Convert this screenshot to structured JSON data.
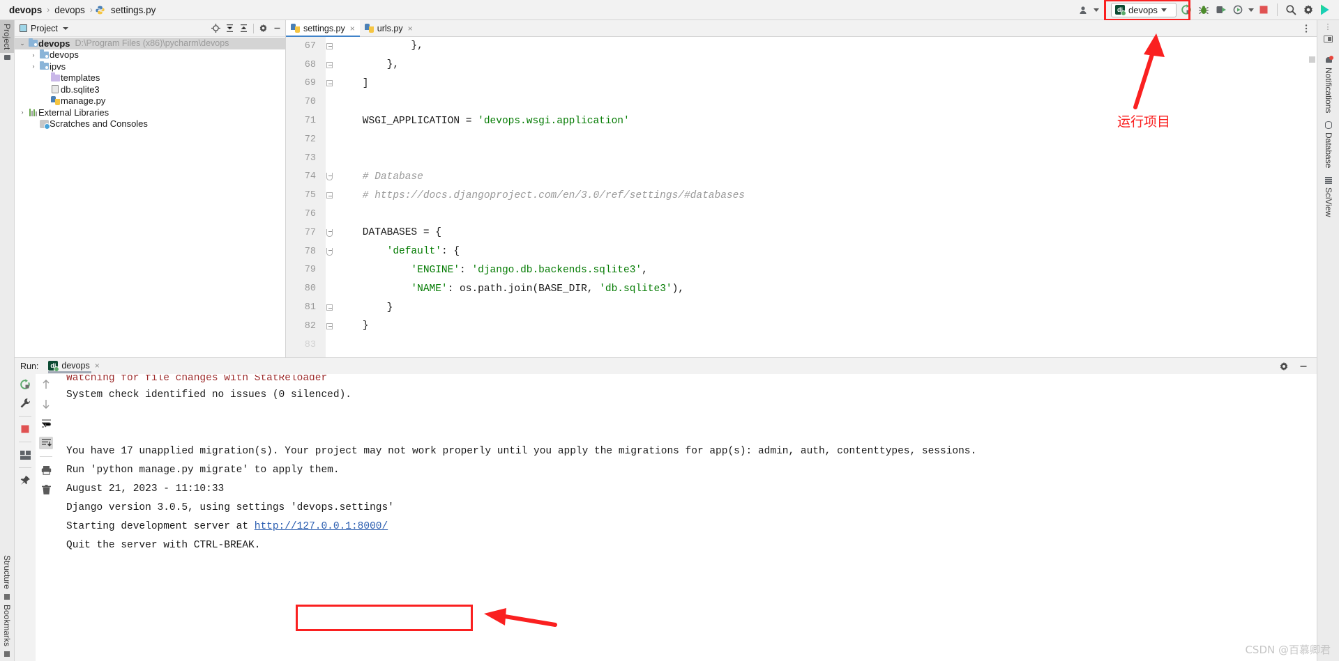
{
  "breadcrumb": {
    "items": [
      {
        "label": "devops",
        "bold": true,
        "icon": ""
      },
      {
        "label": "devops",
        "bold": false,
        "icon": ""
      },
      {
        "label": "settings.py",
        "bold": false,
        "icon": "python-file-icon"
      }
    ],
    "separator": "›"
  },
  "toolbar": {
    "user_icon": "user-profile-icon",
    "run_config_name": "devops",
    "run_config_icon": "django-icon",
    "rerun_icon": "rerun-green-icon",
    "debug_icon": "debug-bug-icon",
    "run_coverage_icon": "run-with-coverage-icon",
    "profile_icon": "profile-icon",
    "stop_icon": "stop-red-square-icon",
    "search_icon": "search-magnifier-icon",
    "settings_icon": "gear-icon",
    "logo_icon": "pycharm-logo-icon"
  },
  "left_rail": {
    "top_tabs": [
      {
        "label": "Project",
        "active": true
      }
    ],
    "bottom_tabs": [
      {
        "label": "Structure",
        "active": false
      },
      {
        "label": "Bookmarks",
        "active": false
      }
    ]
  },
  "project_panel": {
    "title": "Project",
    "icons": [
      "locate-icon",
      "expand-all-icon",
      "collapse-all-icon",
      "gear-icon",
      "minimize-icon"
    ],
    "tree": [
      {
        "label": "devops",
        "path": "D:\\Program Files (x86)\\pycharm\\devops",
        "indent": 0,
        "twisty": "⌄",
        "icon": "folder-root-icon",
        "bold": true,
        "selected": true
      },
      {
        "label": "devops",
        "path": "",
        "indent": 1,
        "twisty": "›",
        "icon": "folder-module-icon",
        "bold": false,
        "selected": false
      },
      {
        "label": "ipvs",
        "path": "",
        "indent": 1,
        "twisty": "›",
        "icon": "folder-module-icon",
        "bold": false,
        "selected": false
      },
      {
        "label": "templates",
        "path": "",
        "indent": 2,
        "twisty": "",
        "icon": "folder-plain-icon",
        "bold": false,
        "selected": false
      },
      {
        "label": "db.sqlite3",
        "path": "",
        "indent": 2,
        "twisty": "",
        "icon": "database-file-icon",
        "bold": false,
        "selected": false
      },
      {
        "label": "manage.py",
        "path": "",
        "indent": 2,
        "twisty": "",
        "icon": "python-file-icon",
        "bold": false,
        "selected": false
      },
      {
        "label": "External Libraries",
        "path": "",
        "indent": 0,
        "twisty": "›",
        "icon": "libraries-icon",
        "bold": false,
        "selected": false
      },
      {
        "label": "Scratches and Consoles",
        "path": "",
        "indent": 1,
        "twisty": "",
        "icon": "scratches-icon",
        "bold": false,
        "selected": false
      }
    ]
  },
  "editor": {
    "tabs": [
      {
        "label": "settings.py",
        "icon": "python-file-icon",
        "active": true,
        "close": "×"
      },
      {
        "label": "urls.py",
        "icon": "python-file-icon",
        "active": false,
        "close": "×"
      }
    ],
    "options_icon": "more-options-icon",
    "lines": [
      {
        "num": "67",
        "fold": "box",
        "segments": [
          {
            "t": "            },",
            "c": "plain"
          }
        ]
      },
      {
        "num": "68",
        "fold": "box",
        "segments": [
          {
            "t": "        },",
            "c": "plain"
          }
        ]
      },
      {
        "num": "69",
        "fold": "box",
        "segments": [
          {
            "t": "    ]",
            "c": "plain"
          }
        ]
      },
      {
        "num": "70",
        "fold": "",
        "segments": [
          {
            "t": "",
            "c": "plain"
          }
        ]
      },
      {
        "num": "71",
        "fold": "",
        "segments": [
          {
            "t": "    WSGI_APPLICATION = ",
            "c": "plain"
          },
          {
            "t": "'devops.wsgi.application'",
            "c": "str"
          }
        ]
      },
      {
        "num": "72",
        "fold": "",
        "segments": [
          {
            "t": "",
            "c": "plain"
          }
        ]
      },
      {
        "num": "73",
        "fold": "",
        "segments": [
          {
            "t": "",
            "c": "plain"
          }
        ]
      },
      {
        "num": "74",
        "fold": "rnd",
        "segments": [
          {
            "t": "    # Database",
            "c": "com"
          }
        ]
      },
      {
        "num": "75",
        "fold": "box",
        "segments": [
          {
            "t": "    # https://docs.djangoproject.com/en/3.0/ref/settings/#databases",
            "c": "com"
          }
        ]
      },
      {
        "num": "76",
        "fold": "",
        "segments": [
          {
            "t": "",
            "c": "plain"
          }
        ]
      },
      {
        "num": "77",
        "fold": "rnd",
        "segments": [
          {
            "t": "    DATABASES = {",
            "c": "plain"
          }
        ]
      },
      {
        "num": "78",
        "fold": "rnd",
        "segments": [
          {
            "t": "        ",
            "c": "plain"
          },
          {
            "t": "'default'",
            "c": "key"
          },
          {
            "t": ": {",
            "c": "plain"
          }
        ]
      },
      {
        "num": "79",
        "fold": "",
        "segments": [
          {
            "t": "            ",
            "c": "plain"
          },
          {
            "t": "'ENGINE'",
            "c": "key"
          },
          {
            "t": ": ",
            "c": "plain"
          },
          {
            "t": "'django.db.backends.sqlite3'",
            "c": "str"
          },
          {
            "t": ",",
            "c": "plain"
          }
        ]
      },
      {
        "num": "80",
        "fold": "",
        "segments": [
          {
            "t": "            ",
            "c": "plain"
          },
          {
            "t": "'NAME'",
            "c": "key"
          },
          {
            "t": ": os.path.join(BASE_DIR, ",
            "c": "plain"
          },
          {
            "t": "'db.sqlite3'",
            "c": "str"
          },
          {
            "t": "),",
            "c": "plain"
          }
        ]
      },
      {
        "num": "81",
        "fold": "box",
        "segments": [
          {
            "t": "        }",
            "c": "plain"
          }
        ]
      },
      {
        "num": "82",
        "fold": "box",
        "segments": [
          {
            "t": "    }",
            "c": "plain"
          }
        ]
      },
      {
        "num": "83",
        "fold": "",
        "segments": [
          {
            "t": "",
            "c": "plain"
          }
        ]
      }
    ]
  },
  "run_panel": {
    "label": "Run:",
    "tab_label": "devops",
    "tab_icon": "django-icon",
    "tab_close": "×",
    "head_icons": [
      "gear-icon",
      "minimize-icon"
    ],
    "tools_left": [
      "rerun-green-icon",
      "wrench-icon",
      "stop-red-square-icon",
      "layout-icon",
      "pin-icon"
    ],
    "tools_right": [
      "scroll-up-icon",
      "scroll-down-icon",
      "soft-wrap-icon",
      "scroll-to-end-icon",
      "print-icon",
      "trash-icon"
    ],
    "console_lines": [
      {
        "text": "Watching for file changes with StatReloader",
        "style": "red",
        "clipped": true
      },
      {
        "text": "System check identified no issues (0 silenced).",
        "style": "plain"
      },
      {
        "text": "",
        "style": "plain"
      },
      {
        "text": "",
        "style": "plain"
      },
      {
        "text": "You have 17 unapplied migration(s). Your project may not work properly until you apply the migrations for app(s): admin, auth, contenttypes, sessions.",
        "style": "plain"
      },
      {
        "text": "Run 'python manage.py migrate' to apply them.",
        "style": "plain"
      },
      {
        "text": "August 21, 2023 - 11:10:33",
        "style": "plain"
      },
      {
        "text": "Django version 3.0.5, using settings 'devops.settings'",
        "style": "plain"
      },
      {
        "text": "Starting development server at ",
        "style": "plain",
        "link": "http://127.0.0.1:8000/"
      },
      {
        "text": "Quit the server with CTRL-BREAK.",
        "style": "plain"
      }
    ]
  },
  "right_rail": {
    "tabs": [
      {
        "label": "Notifications",
        "icon": "bell-icon"
      },
      {
        "label": "Database",
        "icon": "database-icon"
      },
      {
        "label": "SciView",
        "icon": "grid-icon"
      }
    ]
  },
  "annotations": {
    "run_project_text": "运行项目",
    "arrow_color": "#fa2020",
    "box_color": "#fa2020"
  },
  "watermark": "CSDN @百慕卿君"
}
